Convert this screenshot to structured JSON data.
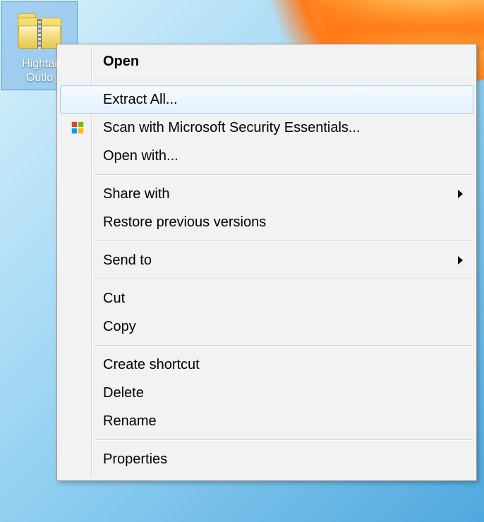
{
  "desktop": {
    "icon_label_line1": "Hightai",
    "icon_label_line2": "Outlo"
  },
  "context_menu": {
    "items": [
      {
        "label": "Open",
        "bold": true
      },
      {
        "label": "Extract All...",
        "highlighted": true
      },
      {
        "label": "Scan with Microsoft Security Essentials...",
        "icon": "mse"
      },
      {
        "label": "Open with..."
      },
      {
        "label": "Share with",
        "submenu": true
      },
      {
        "label": "Restore previous versions"
      },
      {
        "label": "Send to",
        "submenu": true
      },
      {
        "label": "Cut"
      },
      {
        "label": "Copy"
      },
      {
        "label": "Create shortcut"
      },
      {
        "label": "Delete"
      },
      {
        "label": "Rename"
      },
      {
        "label": "Properties"
      }
    ]
  }
}
